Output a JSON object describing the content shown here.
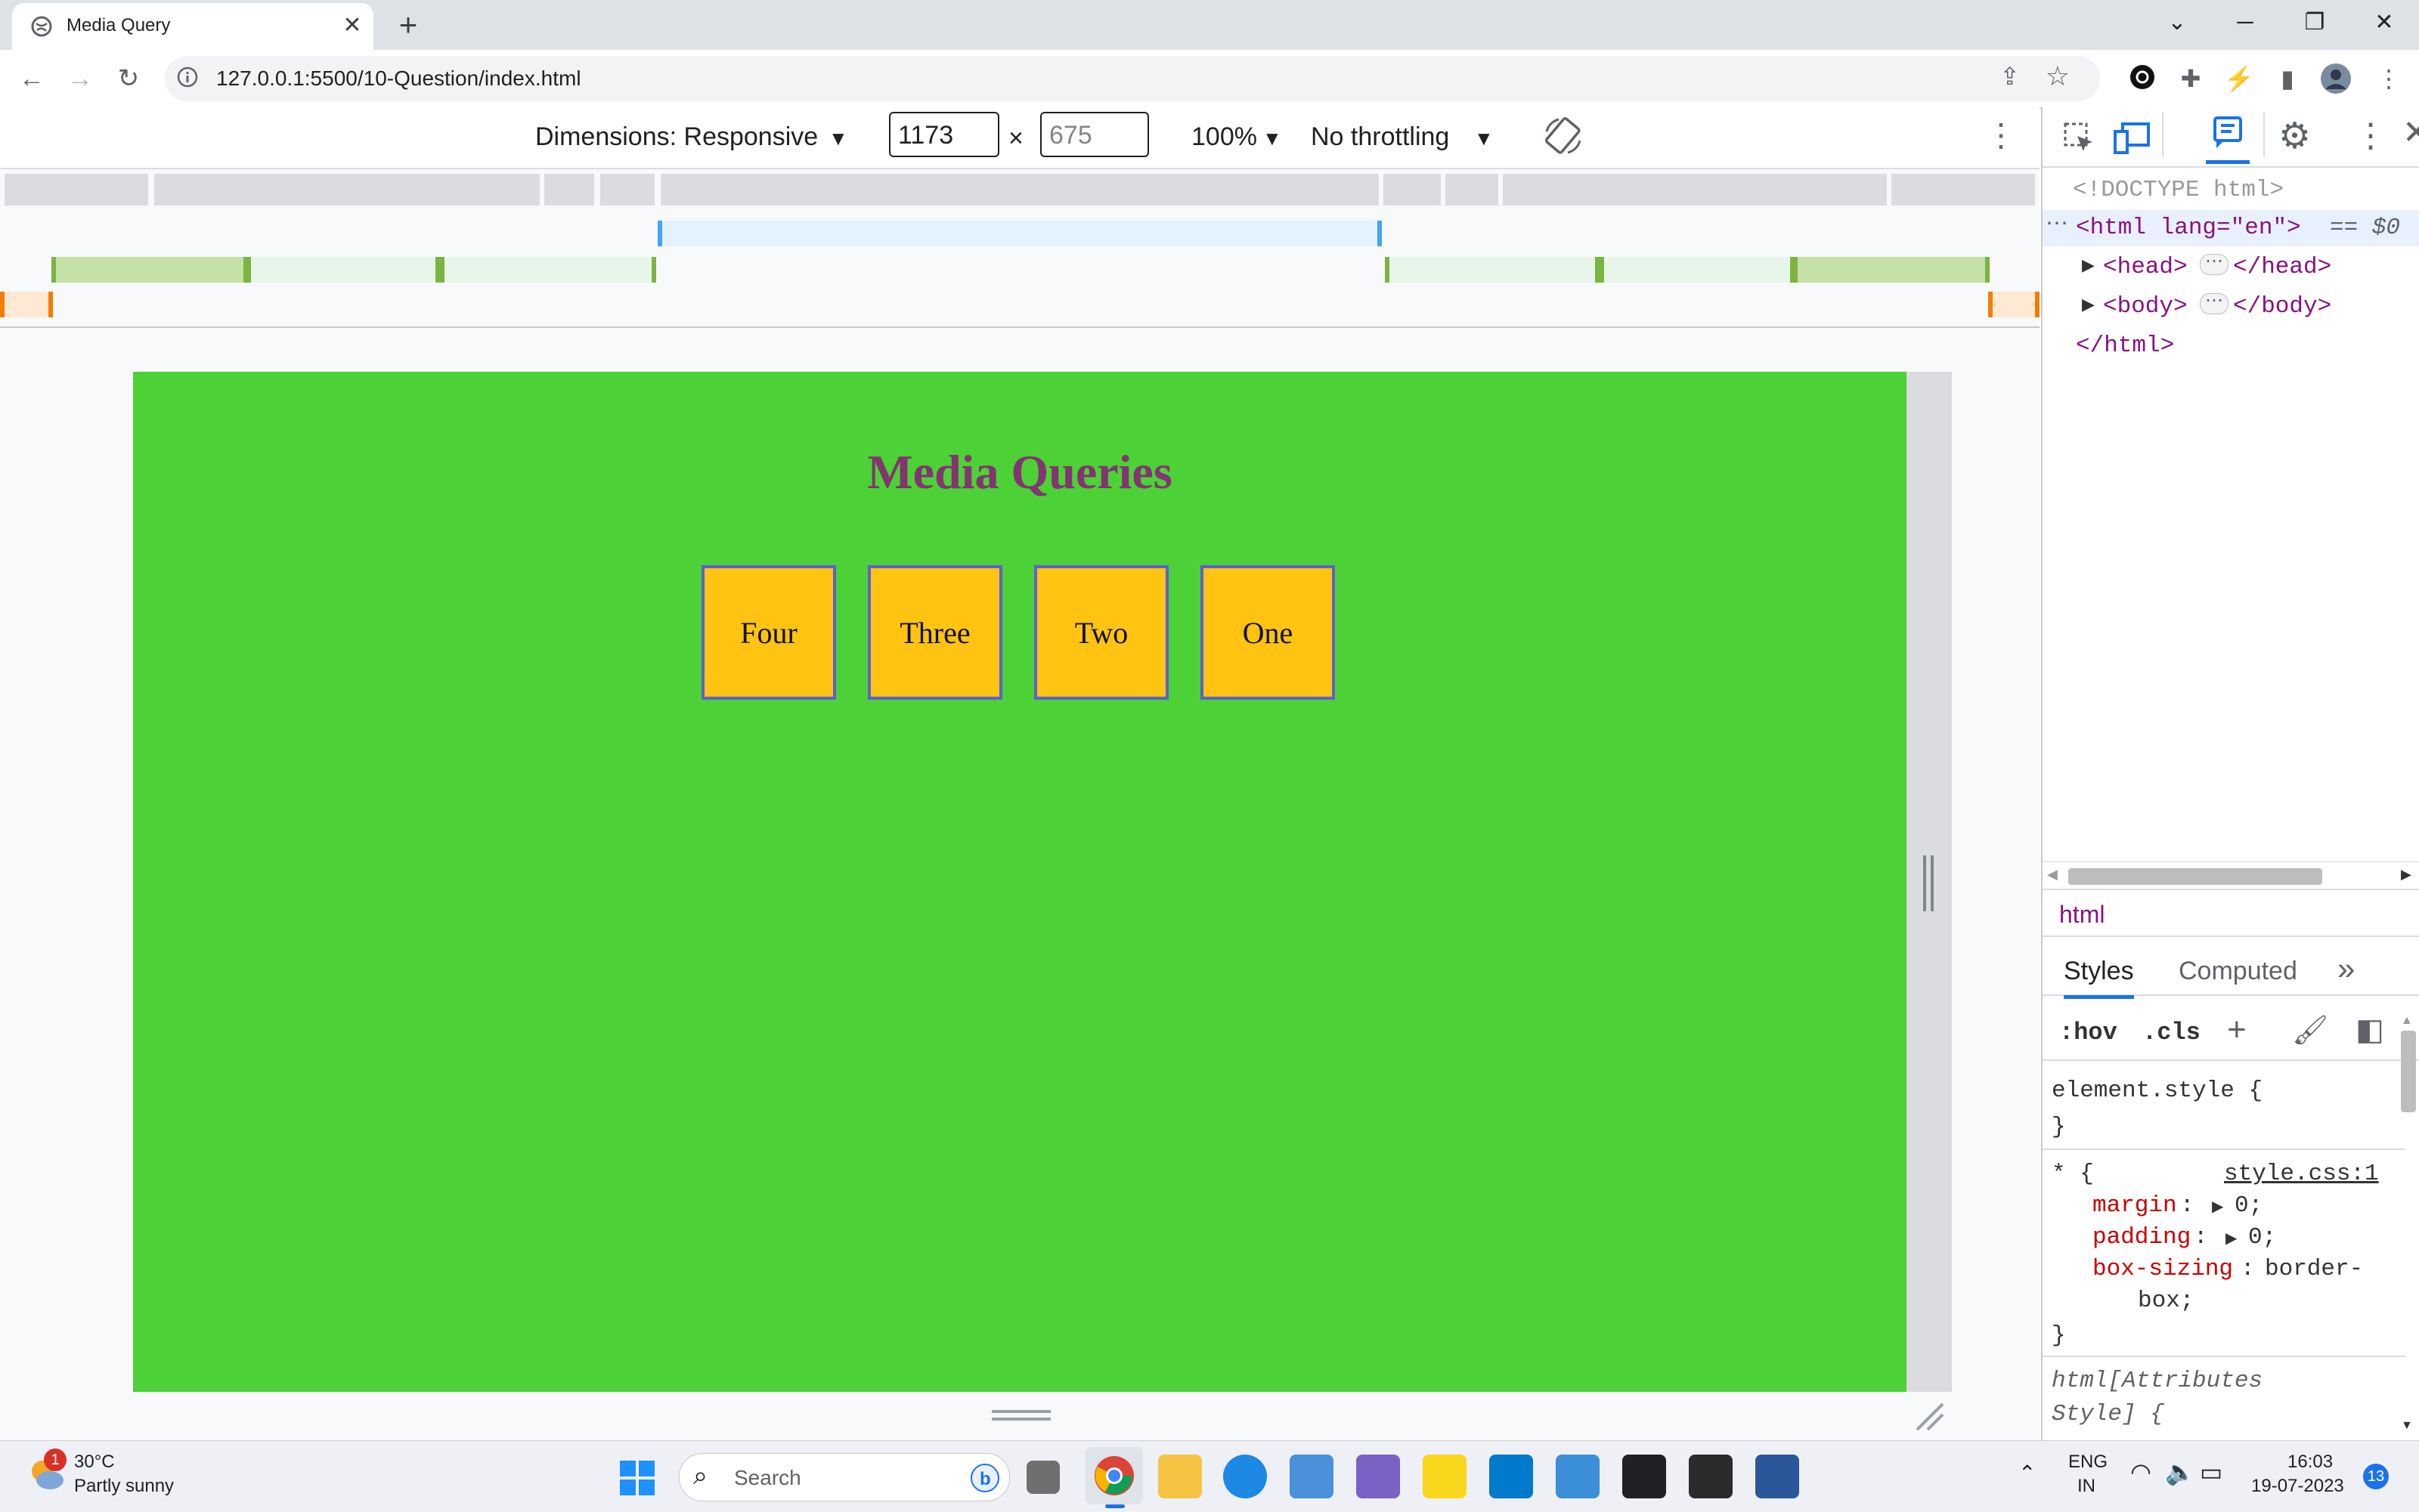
{
  "browser": {
    "tab_title": "Media Query",
    "url": "127.0.0.1:5500/10-Question/index.html"
  },
  "device_toolbar": {
    "dimensions_label": "Dimensions: Responsive",
    "width": "1173",
    "times": "×",
    "height_placeholder": "675",
    "zoom": "100%",
    "throttling": "No throttling"
  },
  "page": {
    "title": "Media Queries",
    "boxes": [
      "Four",
      "Three",
      "Two",
      "One"
    ],
    "colors": {
      "background": "#4cd137",
      "title": "#833471",
      "box": "#ffc312",
      "box_border": "#5f5fd0"
    }
  },
  "devtools": {
    "dom": {
      "doctype": "<!DOCTYPE html>",
      "html_open": "<html lang=\"en\">",
      "selected_marker": "== $0",
      "head": "<head>",
      "head_close": "</head>",
      "body": "<body>",
      "body_close": "</body>",
      "html_close": "</html>"
    },
    "breadcrumb": "html",
    "tabs": {
      "styles": "Styles",
      "computed": "Computed",
      "more": "»"
    },
    "filter": {
      "hov": ":hov",
      "cls": ".cls"
    },
    "styles": {
      "element_style": "element.style {",
      "close_brace": "}",
      "star_selector": "* {",
      "source": "style.css:1",
      "props": [
        {
          "name": "margin",
          "value": "0;"
        },
        {
          "name": "padding",
          "value": "0;"
        },
        {
          "name": "box-sizing",
          "value": "border-"
        }
      ],
      "box_sizing_cont": "box;",
      "attr_style_1": "html[Attributes",
      "attr_style_2": "Style] {"
    }
  },
  "taskbar": {
    "weather_temp": "30°C",
    "weather_desc": "Partly sunny",
    "weather_badge": "1",
    "search_label": "Search",
    "lang_1": "ENG",
    "lang_2": "IN",
    "time": "16:03",
    "date": "19-07-2023",
    "notif_count": "13"
  }
}
